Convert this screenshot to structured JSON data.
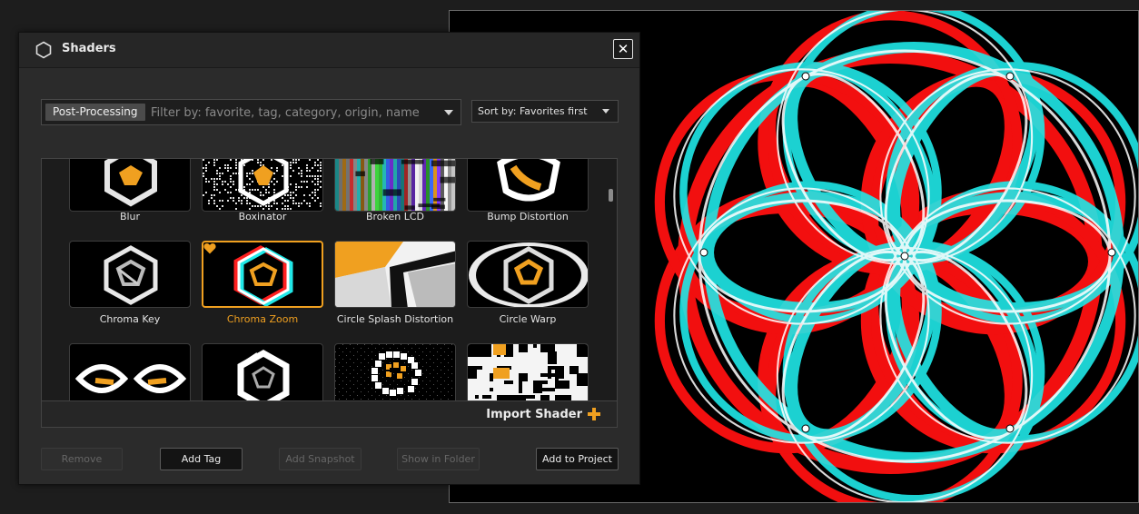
{
  "dialog": {
    "title": "Shaders",
    "title_icon": "hexagon-icon",
    "close_icon": "close-icon",
    "close_label": "✕"
  },
  "filter": {
    "category": "Post-Processing",
    "placeholder": "Filter by: favorite, tag, category, origin, name"
  },
  "sort": {
    "label": "Sort by: Favorites first"
  },
  "tiles": [
    {
      "name": "Blur",
      "selected": false
    },
    {
      "name": "Boxinator",
      "selected": false
    },
    {
      "name": "Broken LCD",
      "selected": false
    },
    {
      "name": "Bump Distortion",
      "selected": false
    },
    {
      "name": "Chroma Key",
      "selected": false
    },
    {
      "name": "Chroma Zoom",
      "selected": true,
      "favorite": true
    },
    {
      "name": "Circle Splash Distortion",
      "selected": false
    },
    {
      "name": "Circle Warp",
      "selected": false
    },
    {
      "name": "",
      "selected": false
    },
    {
      "name": "",
      "selected": false
    },
    {
      "name": "",
      "selected": false
    },
    {
      "name": "",
      "selected": false
    }
  ],
  "import_label": "Import Shader",
  "buttons": {
    "remove": "Remove",
    "add_tag": "Add Tag",
    "add_snapshot": "Add Snapshot",
    "show_in_folder": "Show in Folder",
    "add_to_project": "Add to Project"
  },
  "colors": {
    "accent": "#f0a020",
    "red": "#ff1010",
    "cyan": "#20e8e8"
  }
}
